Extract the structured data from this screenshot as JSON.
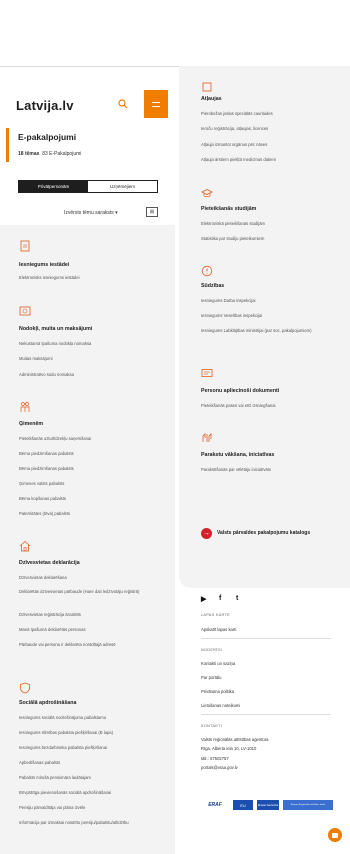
{
  "header": {
    "logo": "Latvija.lv",
    "page_title": "E-pakalpojumi",
    "topics_count": "18 tēmas",
    "services_count": "83 E-Pakalpojumi",
    "toggle": [
      "Privātpersonām",
      "Uzņēmējiem"
    ],
    "sort_label": "Izvērsts tēmu saraksts",
    "colors": {
      "accent": "#f07c00",
      "icon": "#e05a1e"
    }
  },
  "left": {
    "categories": [
      {
        "icon": "document-icon",
        "title": "Iesniegums iestādei",
        "items": [
          "Elektronisks iesniegums iestādei"
        ]
      },
      {
        "icon": "money-icon",
        "title": "Nodokļi, muita un maksājumi",
        "items": [
          "Nekustamā īpašuma nodokļa nomaksa",
          "Muitas maksājumi",
          "Administratīvo sodu nomaksa"
        ]
      },
      {
        "icon": "family-icon",
        "title": "Ģimenēm",
        "items": [
          "Pieteikšanās uzturlīdzekļu saņemšanai",
          "Bērna piedzimšanas pabalsts",
          "Bērna piedzimšanas pabalsts",
          "Ģimenes valsts pabalsts",
          "Bērna kopšanas pabalsts",
          "Paternitātes (tēva) pabalsts"
        ]
      },
      {
        "icon": "house-icon",
        "title": "Dzīvesvietas deklarācija",
        "items": [
          "Dzīvesvietas deklarēšana",
          "Deklarētās dzīvesvietas pārbaude (Hare dati ledzīvotāju reģistrā)",
          "Dzīvesvietas reģistrāciјa ārvalstīs",
          "Manā īpašumā deklarētās personas",
          "Pārbaude vai persona ir deklarēta norādītajā adresē"
        ]
      },
      {
        "icon": "shield-icon",
        "title": "Sociālā apdrošināšana",
        "items": [
          "Iesniegums sociālā nodrošinājuma pabalstamu",
          "Iesniegums slimības pabalsta piešķiršanai (B lapa)",
          "Iesniegums bezdarbnieka pabalsta piešķiršanai",
          "Apbedīšanas pabalsts",
          "Pabalsts mirušā pensionāra laulātajam",
          "Brīvprātīga pievienošanās sociālā apdrošināšanai",
          "Pensiju pārvaldītāja vai plāna izvēle",
          "Informācija par izmaksai nosūtīto pensiju/pabalstu/atlīdzību"
        ]
      }
    ]
  },
  "right": {
    "categories": [
      {
        "icon": "permit-icon",
        "title": "Atļaujas",
        "items": [
          "Pierobežas joslas speciālās caurlaides",
          "Ieroču reģistrācija, atļaujas, licences",
          "Atļauja izmantot orgānus pēc nāves",
          "Atļauja ārstiem piekļūt medicīnas datiem"
        ]
      },
      {
        "icon": "graduation-icon",
        "title": "Pieteikšanās studijām",
        "items": [
          "Elektroniskā pieteikšanās studijām",
          "Statistika par studiju pieteikumiem"
        ]
      },
      {
        "icon": "alert-icon",
        "title": "Sūdzības",
        "items": [
          "Iesniegums Darba inspekcijai",
          "Iesniegums Veselības inspekcijai",
          "Iesniegums Labklājības ministrijai (par soc. pakalpojumiem)"
        ]
      },
      {
        "icon": "id-card-icon",
        "title": "Personu apliecinoši dokumenti",
        "items": [
          "Pieteikšanās pases vai eID izsniegšanai"
        ]
      },
      {
        "icon": "hands-icon",
        "title": "Parakstu vākšana, iniciatīvas",
        "items": [
          "Parakstīšanās par vēlētāju iniciatīvām"
        ]
      }
    ],
    "catalog_link": "Valsts pārvaldes pakalpojumu katalogs"
  },
  "footer": {
    "social": [
      "youtube-icon",
      "facebook-icon",
      "twitter-icon"
    ],
    "sitemap_head": "LAPAS KARTE",
    "sitemap_link": "Apskatīt lapas karti",
    "useful_head": "NODERĪGI",
    "useful_links": [
      "Kontakti un saziņa",
      "Par portālu",
      "Privātuma politika",
      "Lietošanas noteikumi"
    ],
    "contact_head": "KONTAKTI",
    "contact_lines": [
      "Valsts reģionālās attīstības aģentūra",
      "Rīga, Alberta iela 10, LV-1010",
      "tālr.: 67502757",
      "portals@vraa.gov.lv"
    ],
    "logos": [
      "ERAF",
      "EU",
      "Eiropas Savienība",
      "Eiropas Reģionālās attīstības fonds"
    ]
  }
}
